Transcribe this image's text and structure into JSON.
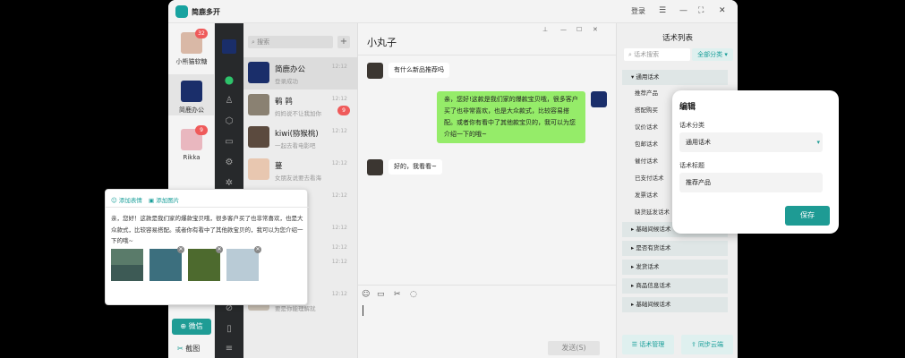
{
  "app": {
    "title": "简鹿多开"
  },
  "titlebar": {
    "login": "登录",
    "menu": "☰",
    "minimize": "—",
    "fullscreen": "⛶",
    "close": "✕"
  },
  "accounts": [
    {
      "name": "小熊猫软糖",
      "badge": "32"
    },
    {
      "name": "简鹿办公",
      "badge": ""
    },
    {
      "name": "Rikka",
      "badge": "9"
    }
  ],
  "dock": {
    "wechat": "微信",
    "screenshot": "截图"
  },
  "chatlist": {
    "search_placeholder": "搜索",
    "items": [
      {
        "name": "简鹿办公",
        "preview": "登录成功",
        "time": "12:12",
        "badge": ""
      },
      {
        "name": "鹌 鹑",
        "preview": "妈妈说不让我加你",
        "time": "12:12",
        "badge": "9"
      },
      {
        "name": "kiwi(猕猴桃)",
        "preview": "一起去看电影吧",
        "time": "12:12",
        "badge": ""
      },
      {
        "name": "蔓",
        "preview": "女朋友说要去看海",
        "time": "12:12",
        "badge": ""
      },
      {
        "name": "",
        "preview": "",
        "time": "12:12",
        "badge": ""
      },
      {
        "name": "",
        "preview": "",
        "time": "12:12",
        "badge": ""
      },
      {
        "name": "",
        "preview": "",
        "time": "12:12",
        "badge": ""
      },
      {
        "name": "水",
        "preview": "",
        "time": "12:12",
        "badge": ""
      },
      {
        "name": "",
        "preview": "要是你能理解就",
        "time": "12:12",
        "badge": ""
      }
    ]
  },
  "chat": {
    "name": "小丸子",
    "messages": [
      {
        "from": "other",
        "text": "有什么新品推荐吗"
      },
      {
        "from": "me",
        "text": "亲，您好!这款是我们家的爆款宝贝哦，很多客户买了也非常喜欢，也是大众款式，比较容易搭配。或者你有看中了其他款宝贝的，我可以为您介绍一下的哦~"
      },
      {
        "from": "other",
        "text": "好的，我看看~"
      }
    ],
    "send": "发送(S)"
  },
  "popup": {
    "add_emoji": "添加表情",
    "add_image": "添加图片",
    "text": "亲，您好！这款是我们家的爆款宝贝哦，很多客户买了也非常喜欢，也是大众款式，比较容易搭配。或者你有看中了其他款宝贝的，我可以为您介绍一下的哦~"
  },
  "scripts": {
    "title": "话术列表",
    "search_placeholder": "话术搜索",
    "category": "全部分类",
    "groups": [
      {
        "label": "通用话术",
        "expanded": true,
        "items": [
          "推荐产品",
          "搭配购买",
          "议价话术",
          "包邮话术",
          "催付话术",
          "已支付话术",
          "发票话术",
          "缺货延发话术"
        ]
      },
      {
        "label": "基础间候话术",
        "expanded": false,
        "items": []
      },
      {
        "label": "是否有货话术",
        "expanded": false,
        "items": []
      },
      {
        "label": "发货话术",
        "expanded": false,
        "items": []
      },
      {
        "label": "商品信息话术",
        "expanded": false,
        "items": []
      },
      {
        "label": "基础间候话术",
        "expanded": false,
        "items": []
      }
    ],
    "manage": "话术管理",
    "sync": "同步云端"
  },
  "edit": {
    "title": "编辑",
    "category_label": "话术分类",
    "category_value": "通用话术",
    "title_label": "话术标题",
    "title_value": "推荐产品",
    "save": "保存"
  },
  "colors": {
    "accent": "#1f9c95",
    "bubble_me": "#95ec69",
    "badge": "#ef5a5a"
  }
}
